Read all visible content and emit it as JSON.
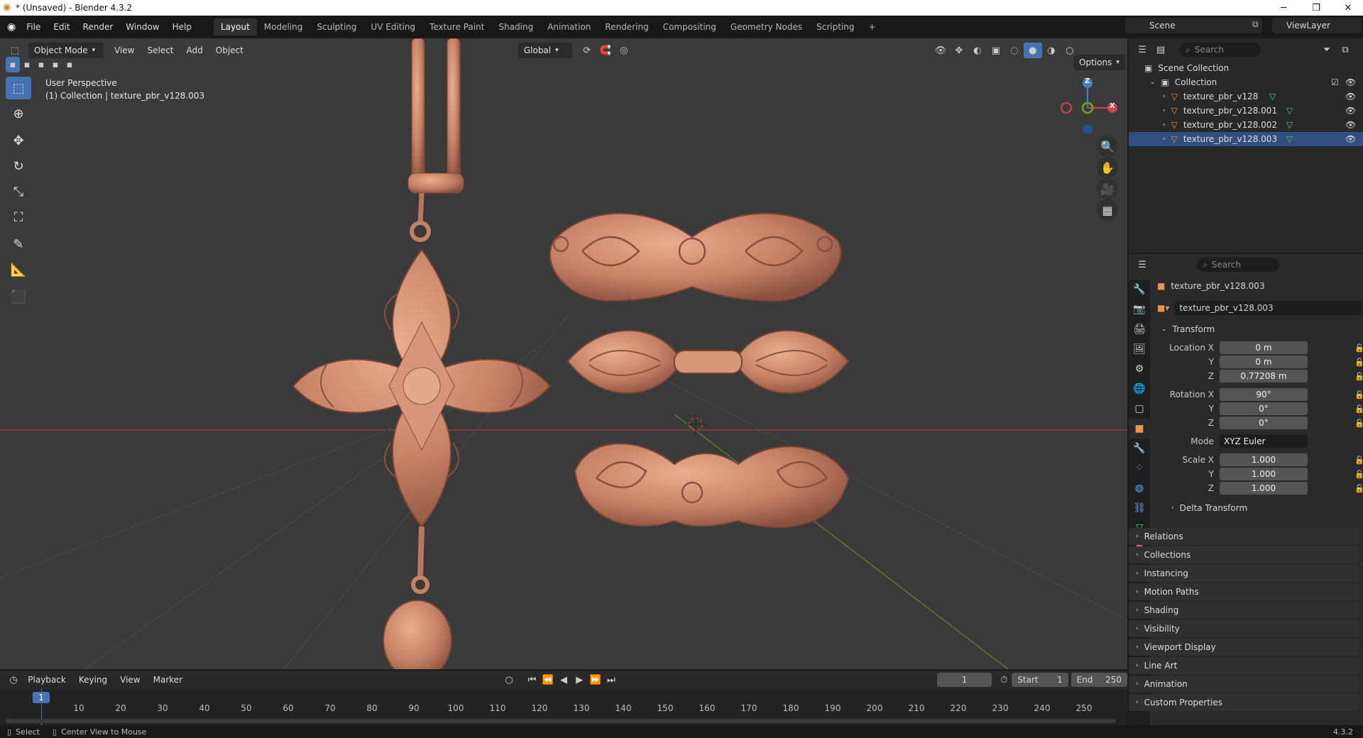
{
  "window": {
    "title": "* (Unsaved) - Blender 4.3.2",
    "minimize": "─",
    "maximize": "❐",
    "close": "✕"
  },
  "menu": {
    "items": [
      "File",
      "Edit",
      "Render",
      "Window",
      "Help"
    ]
  },
  "workspaces": {
    "tabs": [
      "Layout",
      "Modeling",
      "Sculpting",
      "UV Editing",
      "Texture Paint",
      "Shading",
      "Animation",
      "Rendering",
      "Compositing",
      "Geometry Nodes",
      "Scripting"
    ],
    "active": "Layout",
    "add": "+"
  },
  "scene": {
    "label": "Scene",
    "viewlayer": "ViewLayer"
  },
  "viewport": {
    "mode": "Object Mode",
    "menus": [
      "View",
      "Select",
      "Add",
      "Object"
    ],
    "orientation": "Global",
    "info_line1": "User Perspective",
    "info_line2": "(1) Collection | texture_pbr_v128.003",
    "options": "Options",
    "gizmo": {
      "z": "Z",
      "x": "X"
    }
  },
  "outliner": {
    "search_placeholder": "Search",
    "root": "Scene Collection",
    "collection": "Collection",
    "objects": [
      "texture_pbr_v128",
      "texture_pbr_v128.001",
      "texture_pbr_v128.002",
      "texture_pbr_v128.003"
    ]
  },
  "properties": {
    "search_placeholder": "Search",
    "object_name": "texture_pbr_v128.003",
    "data_name": "texture_pbr_v128.003",
    "transform_label": "Transform",
    "location": {
      "label": "Location X",
      "x": "0 m",
      "y": "0 m",
      "z": "0.77208 m"
    },
    "rotation": {
      "label": "Rotation X",
      "x": "90°",
      "y": "0°",
      "z": "0°"
    },
    "mode": {
      "label": "Mode",
      "value": "XYZ Euler"
    },
    "scale": {
      "label": "Scale X",
      "x": "1.000",
      "y": "1.000",
      "z": "1.000"
    },
    "axis_y": "Y",
    "axis_z": "Z",
    "delta": "Delta Transform",
    "panels": [
      "Relations",
      "Collections",
      "Instancing",
      "Motion Paths",
      "Shading",
      "Visibility",
      "Viewport Display",
      "Line Art",
      "Animation",
      "Custom Properties"
    ]
  },
  "timeline": {
    "menus": [
      "Playback",
      "Keying",
      "View",
      "Marker"
    ],
    "current_frame": "1",
    "start_label": "Start",
    "start": "1",
    "end_label": "End",
    "end": "250",
    "ticks": [
      "1",
      "10",
      "20",
      "30",
      "40",
      "50",
      "60",
      "70",
      "80",
      "90",
      "100",
      "110",
      "120",
      "130",
      "140",
      "150",
      "160",
      "170",
      "180",
      "190",
      "200",
      "210",
      "220",
      "230",
      "240",
      "250"
    ]
  },
  "status": {
    "select": "Select",
    "center": "Center View to Mouse",
    "version": "4.3.2"
  },
  "colors": {
    "accent": "#4772b3",
    "copper": "#c9876a",
    "x_axis": "#d2444f",
    "y_axis": "#6b9a2f",
    "z_axis": "#3d7fd6"
  }
}
